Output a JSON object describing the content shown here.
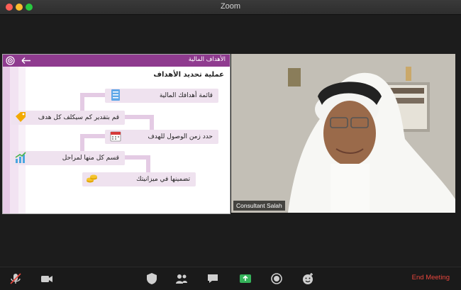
{
  "window": {
    "title": "Zoom"
  },
  "slide": {
    "header_title": "الأهداف المالية",
    "main_title": "عملية تحديد الأهداف",
    "steps": [
      {
        "label": "قائمة أهدافك المالية",
        "icon": "checklist-icon"
      },
      {
        "label": "قم بتقدير كم سيكلف كل هدف",
        "icon": "price-tag-icon"
      },
      {
        "label": "حدد زمن الوصول للهدف",
        "icon": "calendar-icon"
      },
      {
        "label": "قسم كل منها لمراحل",
        "icon": "growth-chart-icon"
      },
      {
        "label": "تضمينها في ميزانيتك",
        "icon": "coins-icon"
      }
    ]
  },
  "video": {
    "participant_name": "Consultant Salah"
  },
  "toolbar": {
    "end_meeting_label": "End Meeting"
  },
  "colors": {
    "slide_header": "#8f3b8f",
    "step_fill": "#efe2ef",
    "end_meeting": "#e8463d"
  }
}
